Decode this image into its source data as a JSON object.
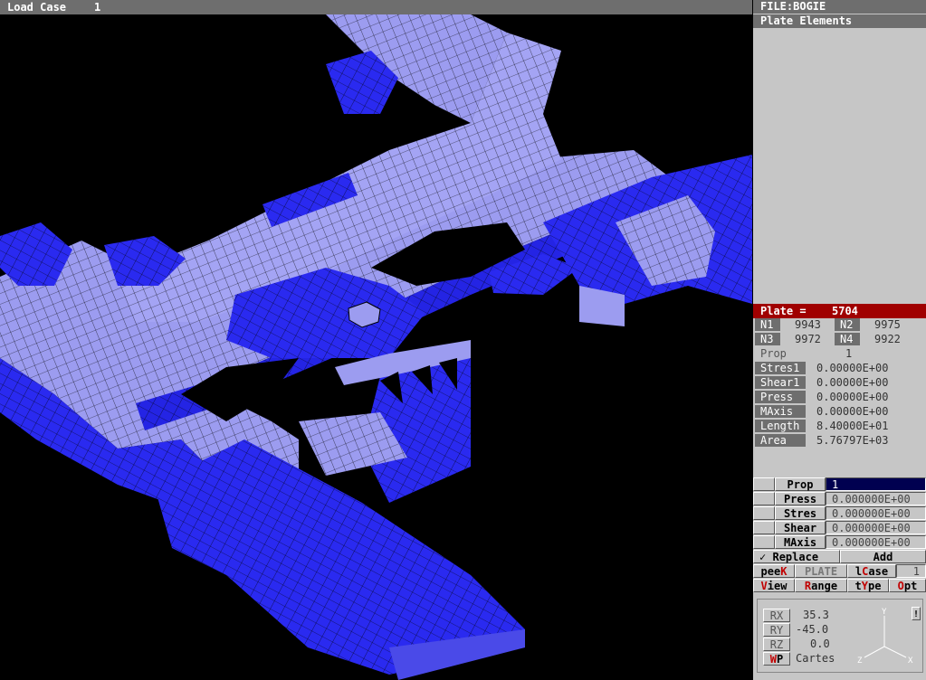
{
  "topbar": {
    "load_case_label": "Load Case",
    "load_case_value": "1"
  },
  "panel": {
    "file_title": "FILE:BOGIE",
    "section_title": "Plate Elements",
    "plate_label": "Plate =",
    "plate_id": "5704",
    "nodes": [
      {
        "label": "N1",
        "value": "9943"
      },
      {
        "label": "N2",
        "value": "9975"
      },
      {
        "label": "N3",
        "value": "9972"
      },
      {
        "label": "N4",
        "value": "9922"
      }
    ],
    "props": [
      {
        "label": "Prop",
        "value": "1"
      },
      {
        "label": "Stres1",
        "value": "0.00000E+00"
      },
      {
        "label": "Shear1",
        "value": "0.00000E+00"
      },
      {
        "label": "Press",
        "value": "0.00000E+00"
      },
      {
        "label": "MAxis",
        "value": "0.00000E+00"
      },
      {
        "label": "Length",
        "value": "8.40000E+01"
      },
      {
        "label": "Area",
        "value": "5.76797E+03"
      }
    ],
    "edit_fields": [
      {
        "label": "Prop",
        "value": "1"
      },
      {
        "label": "Press",
        "value": "0.000000E+00"
      },
      {
        "label": "Stres",
        "value": "0.000000E+00"
      },
      {
        "label": "Shear",
        "value": "0.000000E+00"
      },
      {
        "label": "MAxis",
        "value": "0.000000E+00"
      }
    ],
    "replace_label": "Replace",
    "replace_check": "✓",
    "add_label": "Add",
    "menu1": [
      {
        "pre": "pee",
        "hot": "K",
        "post": ""
      },
      {
        "pre": "PLATE",
        "hot": "",
        "post": ""
      },
      {
        "pre": "l",
        "hot": "C",
        "post": "ase"
      }
    ],
    "lcase_value": "1",
    "menu2": [
      {
        "pre": "",
        "hot": "V",
        "post": "iew"
      },
      {
        "pre": "",
        "hot": "R",
        "post": "ange"
      },
      {
        "pre": "t",
        "hot": "Y",
        "post": "pe"
      },
      {
        "pre": "",
        "hot": "O",
        "post": "pt"
      }
    ],
    "view": {
      "rx_label": "RX",
      "rx_value": "35.3",
      "ry_label": "RY",
      "ry_value": "-45.0",
      "rz_label": "RZ",
      "rz_value": "0.0",
      "wp_pre": "W",
      "wp_post": "P",
      "coord_system": "Cartes",
      "axis_x": "X",
      "axis_y": "Y",
      "axis_z": "Z",
      "marker": "!"
    }
  },
  "colors": {
    "mesh_dark": "#2020e0",
    "mesh_light": "#9c9cf0",
    "plate_highlight": "#a00000",
    "title_bar": "#6e6e6e",
    "panel_bg": "#c6c6c6"
  }
}
